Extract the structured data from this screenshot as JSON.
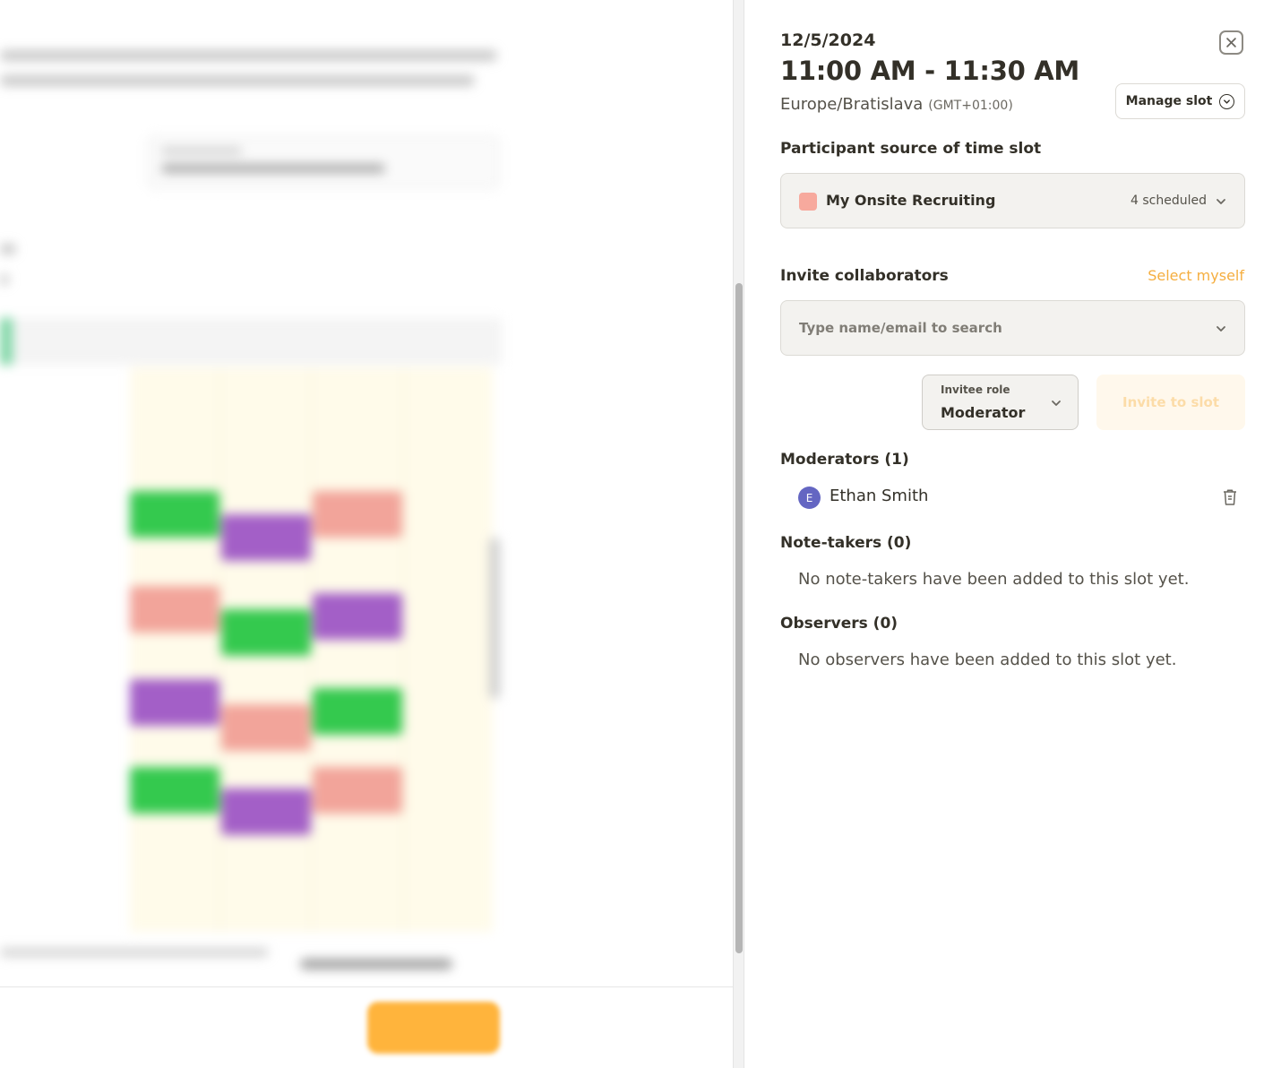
{
  "slot": {
    "date": "12/5/2024",
    "time_range": "11:00 AM - 11:30 AM",
    "timezone": "Europe/Bratislava",
    "timezone_offset": "(GMT+01:00)",
    "manage_label": "Manage slot"
  },
  "participant_source": {
    "heading": "Participant source of time slot",
    "name": "My Onsite Recruiting",
    "scheduled": "4 scheduled",
    "swatch_color": "#f7a99d"
  },
  "invite": {
    "heading": "Invite collaborators",
    "select_myself": "Select myself",
    "search_placeholder": "Type name/email to search",
    "role_label": "Invitee role",
    "role_value": "Moderator",
    "invite_button": "Invite to slot"
  },
  "moderators": {
    "heading": "Moderators (1)",
    "people": [
      {
        "initial": "E",
        "name": "Ethan Smith",
        "avatar_color": "#6466c2"
      }
    ]
  },
  "note_takers": {
    "heading": "Note-takers (0)",
    "empty": "No note-takers have been added to this slot yet."
  },
  "observers": {
    "heading": "Observers (0)",
    "empty": "No observers have been added to this slot yet."
  },
  "colors": {
    "accent": "#f5ae3f",
    "event_green": "#34c94e",
    "event_purple": "#a35fc7",
    "event_salmon": "#f2a49a"
  }
}
